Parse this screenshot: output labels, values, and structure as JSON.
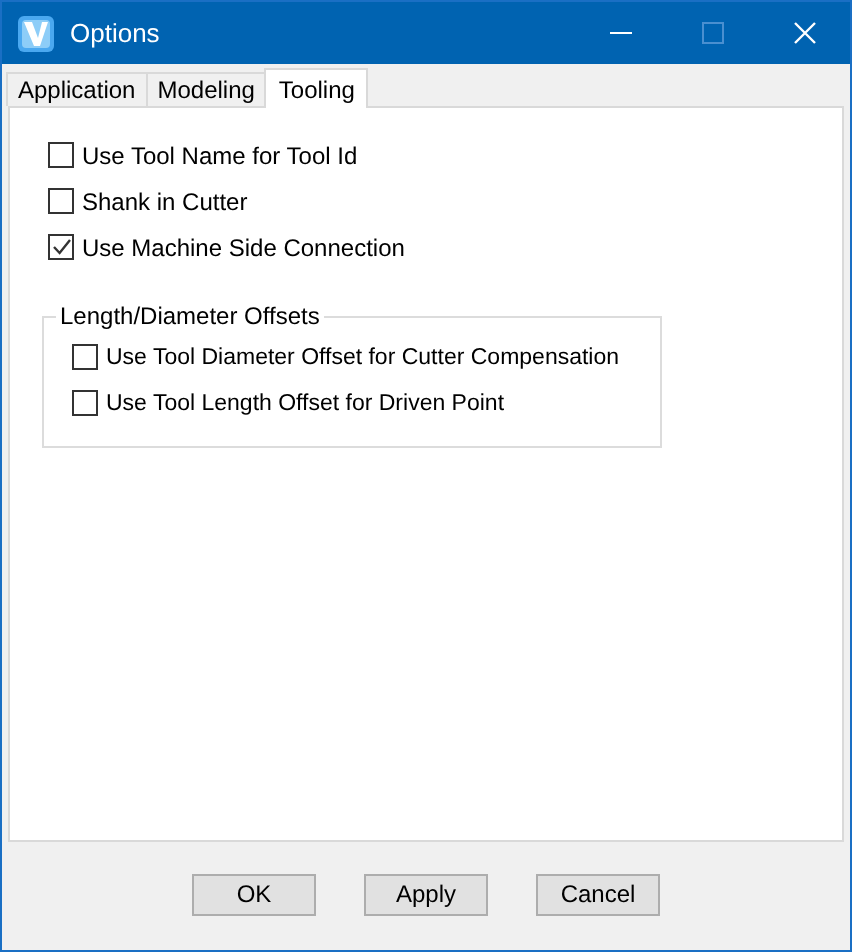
{
  "window": {
    "title": "Options"
  },
  "tabs": [
    {
      "label": "Application",
      "selected": false
    },
    {
      "label": "Modeling",
      "selected": false
    },
    {
      "label": "Tooling",
      "selected": true
    }
  ],
  "options": [
    {
      "label": "Use Tool Name for Tool Id",
      "checked": false
    },
    {
      "label": "Shank in Cutter",
      "checked": false
    },
    {
      "label": "Use Machine Side Connection",
      "checked": true
    }
  ],
  "group": {
    "title": "Length/Diameter Offsets",
    "options": [
      {
        "label": "Use Tool Diameter Offset for Cutter Compensation",
        "checked": false
      },
      {
        "label": "Use Tool Length Offset for Driven Point",
        "checked": false
      }
    ]
  },
  "buttons": [
    "OK",
    "Apply",
    "Cancel"
  ]
}
